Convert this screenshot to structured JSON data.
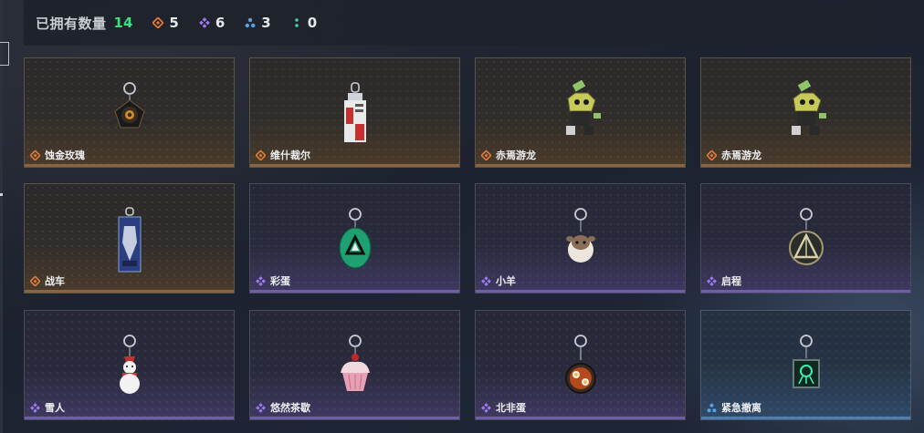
{
  "header": {
    "owned_label": "已拥有数量",
    "owned_total": "14",
    "stats": [
      {
        "icon": "orange-diamond-icon",
        "color": "#e07a3a",
        "value": "5"
      },
      {
        "icon": "purple-diamond-icon",
        "color": "#9b7bf0",
        "value": "6"
      },
      {
        "icon": "blue-triangle-icon",
        "color": "#5aa2e8",
        "value": "3"
      },
      {
        "icon": "green-dots-icon",
        "color": "#3fd49a",
        "value": "0"
      }
    ]
  },
  "colors": {
    "orange": "#e07a3a",
    "purple": "#9b7bf0",
    "blue": "#5aa2e8",
    "green": "#3fe07a"
  },
  "cards": [
    {
      "name": "蚀金玫瑰",
      "rarity": "orange",
      "charm": "rose-charm-icon"
    },
    {
      "name": "维什裁尔",
      "rarity": "orange",
      "charm": "tag-charm-icon"
    },
    {
      "name": "赤焉游龙",
      "rarity": "orange",
      "charm": "dragon-charm-icon"
    },
    {
      "name": "赤焉游龙",
      "rarity": "orange",
      "charm": "dragon-charm-icon"
    },
    {
      "name": "战车",
      "rarity": "orange",
      "charm": "card-charm-icon"
    },
    {
      "name": "彩蛋",
      "rarity": "purple",
      "charm": "egg-charm-icon"
    },
    {
      "name": "小羊",
      "rarity": "purple",
      "charm": "sheep-charm-icon"
    },
    {
      "name": "启程",
      "rarity": "purple",
      "charm": "compass-charm-icon"
    },
    {
      "name": "雪人",
      "rarity": "purple",
      "charm": "snowman-charm-icon"
    },
    {
      "name": "悠然茶歇",
      "rarity": "purple",
      "charm": "cupcake-charm-icon"
    },
    {
      "name": "北非蛋",
      "rarity": "purple",
      "charm": "pan-charm-icon"
    },
    {
      "name": "紧急撤离",
      "rarity": "blue",
      "charm": "tag-glow-charm-icon"
    }
  ]
}
